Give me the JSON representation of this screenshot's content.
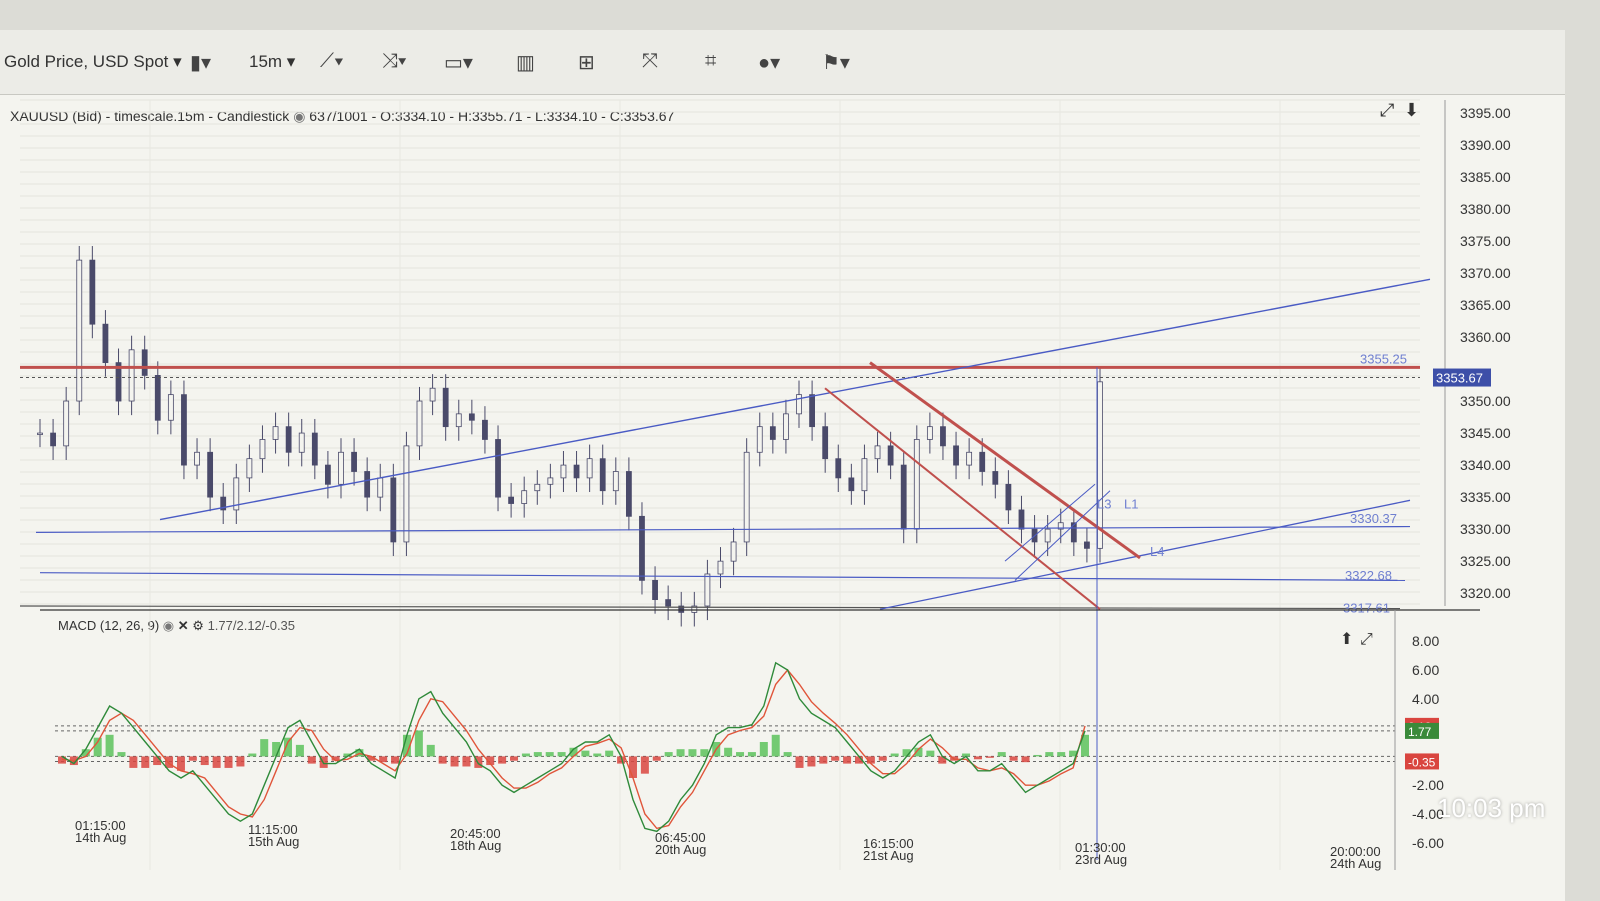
{
  "toolbar": {
    "instrument": "Gold Price, USD Spot",
    "timeframe": "15m"
  },
  "info_line": {
    "text": "XAUUSD (Bid) - timescale.15m - Candlestick",
    "ohlc": "637/1001 - O:3334.10 - H:3355.71 - L:3334.10 - C:3353.67"
  },
  "macd": {
    "label": "MACD (12, 26, 9)",
    "values": "1.77/2.12/-0.35",
    "badges": [
      "2.12",
      "1.77",
      "-0.35"
    ]
  },
  "clock": "10:03 pm",
  "chart_data": [
    {
      "type": "candlestick",
      "price_axis": {
        "ticks": [
          "3395.00",
          "3390.00",
          "3385.00",
          "3380.00",
          "3375.00",
          "3370.00",
          "3365.00",
          "3360.00",
          "3350.00",
          "3345.00",
          "3340.00",
          "3335.00",
          "3330.00",
          "3325.00",
          "3320.00"
        ],
        "ylim": [
          3318,
          3397
        ],
        "last_price": "3353.67"
      },
      "levels": [
        {
          "label": "3355.25",
          "value": 3355.25,
          "color": "#c0504d"
        },
        {
          "label": "3330.37",
          "value": 3330.37,
          "color": "#4a5bc4"
        },
        {
          "label": "3322.68",
          "value": 3322.68,
          "color": "#4a5bc4"
        },
        {
          "label": "3317.61",
          "value": 3317.61,
          "color": "#4a5bc4"
        }
      ],
      "line_labels": [
        "L3",
        "L1",
        "L4"
      ],
      "close": [
        3345,
        3343,
        3350,
        3372,
        3362,
        3356,
        3350,
        3358,
        3354,
        3347,
        3351,
        3340,
        3342,
        3335,
        3333,
        3338,
        3341,
        3344,
        3346,
        3342,
        3345,
        3340,
        3337,
        3342,
        3339,
        3335,
        3338,
        3328,
        3343,
        3350,
        3352,
        3346,
        3348,
        3347,
        3344,
        3335,
        3334,
        3336,
        3337,
        3338,
        3340,
        3338,
        3341,
        3336,
        3339,
        3332,
        3322,
        3319,
        3318,
        3317,
        3318,
        3323,
        3325,
        3328,
        3342,
        3346,
        3344,
        3348,
        3351,
        3346,
        3341,
        3338,
        3336,
        3341,
        3343,
        3340,
        3330,
        3344,
        3346,
        3343,
        3340,
        3342,
        3339,
        3337,
        3333,
        3330,
        3328,
        3330,
        3331,
        3328,
        3327,
        3353
      ]
    },
    {
      "type": "line",
      "name": "MACD (12, 26, 9)",
      "y_ticks": [
        "8.00",
        "6.00",
        "4.00",
        "-2.00",
        "-4.00",
        "-6.00"
      ],
      "ylim": [
        -6.5,
        8.5
      ],
      "x_labels": [
        {
          "time": "01:15:00",
          "date": "14th Aug"
        },
        {
          "time": "11:15:00",
          "date": "15th Aug"
        },
        {
          "time": "20:45:00",
          "date": "18th Aug"
        },
        {
          "time": "06:45:00",
          "date": "20th Aug"
        },
        {
          "time": "16:15:00",
          "date": "21st Aug"
        },
        {
          "time": "01:30:00",
          "date": "23rd Aug"
        },
        {
          "time": "20:00:00",
          "date": "24th Aug"
        }
      ],
      "macd_line": [
        0,
        -0.5,
        0.5,
        2,
        3.5,
        3,
        2,
        1,
        0,
        -1,
        -1.5,
        -1,
        -2,
        -3,
        -4,
        -4.5,
        -4,
        -2,
        0,
        2,
        2.5,
        1,
        -0.5,
        -0.5,
        0,
        0.5,
        -0.5,
        -1,
        -1.5,
        1.5,
        4,
        4.5,
        3,
        2,
        1,
        -0.5,
        -1,
        -2,
        -2.5,
        -2,
        -1.5,
        -1,
        -0.5,
        0.5,
        1,
        1,
        1.5,
        0,
        -3,
        -5,
        -5.2,
        -4.5,
        -3,
        -2,
        -0.5,
        1.5,
        2,
        2,
        2.2,
        3.5,
        6.5,
        6,
        4,
        3,
        2.5,
        2,
        1,
        0,
        -1,
        -1.5,
        -1,
        0,
        1,
        1.5,
        0,
        -0.5,
        0,
        -1,
        -1,
        -0.5,
        -1.5,
        -2.5,
        -2,
        -1.5,
        -1,
        -0.5,
        1.77
      ],
      "signal_line": [
        -0.2,
        -0.3,
        0,
        1,
        2.5,
        3,
        2.5,
        1.5,
        0.5,
        -0.5,
        -1,
        -1.2,
        -1.5,
        -2.5,
        -3.5,
        -4,
        -4.2,
        -3,
        -1,
        1,
        2,
        1.8,
        0.5,
        -0.3,
        -0.2,
        0.2,
        0,
        -0.5,
        -1,
        0.2,
        2.5,
        4,
        3.8,
        2.8,
        1.8,
        0.5,
        -0.5,
        -1.5,
        -2.2,
        -2.2,
        -1.8,
        -1.2,
        -0.8,
        0,
        0.7,
        0.9,
        1.2,
        0.6,
        -1.5,
        -4,
        -5,
        -4.8,
        -3.5,
        -2.5,
        -1,
        0.5,
        1.5,
        1.8,
        2,
        2.8,
        5,
        6,
        5,
        3.8,
        3,
        2.3,
        1.5,
        0.5,
        -0.5,
        -1.2,
        -1.2,
        -0.5,
        0.5,
        1.2,
        0.6,
        -0.2,
        -0.2,
        -0.8,
        -1,
        -0.8,
        -1.2,
        -2,
        -2,
        -1.7,
        -1.2,
        -0.8,
        2.12
      ],
      "histogram": [
        -0.5,
        -0.6,
        0.5,
        1.3,
        1.5,
        0.3,
        -0.8,
        -0.8,
        -0.6,
        -0.8,
        -1,
        -0.3,
        -0.6,
        -0.8,
        -0.8,
        -0.7,
        0.2,
        1.2,
        1,
        1.3,
        0.8,
        -0.5,
        -0.8,
        -0.3,
        0.2,
        0.5,
        -0.3,
        -0.4,
        -0.5,
        1.5,
        1.8,
        0.8,
        -0.5,
        -0.7,
        -0.7,
        -0.8,
        -0.6,
        -0.5,
        -0.3,
        0.2,
        0.3,
        0.3,
        0.3,
        0.6,
        0.4,
        0.2,
        0.4,
        -0.5,
        -1.5,
        -1.2,
        -0.3,
        0.3,
        0.5,
        0.5,
        0.5,
        1,
        0.6,
        0.3,
        0.3,
        1,
        1.5,
        0.3,
        -0.8,
        -0.7,
        -0.5,
        -0.3,
        -0.5,
        -0.5,
        -0.5,
        -0.3,
        0.2,
        0.5,
        0.6,
        0.4,
        -0.5,
        -0.3,
        0.2,
        -0.2,
        -0.1,
        0.3,
        -0.3,
        -0.4,
        0.1,
        0.3,
        0.3,
        0.4,
        1.5
      ]
    }
  ]
}
